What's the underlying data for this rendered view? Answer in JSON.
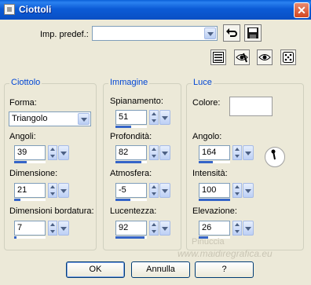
{
  "window": {
    "title": "Ciottoli",
    "close_glyph": "✕"
  },
  "preset": {
    "label": "Imp. predef.:",
    "value": ""
  },
  "toolbar": {
    "icons": [
      "undo-icon",
      "save-icon",
      "settings-list-icon",
      "hide-show-icon",
      "eye-icon",
      "randomize-dice-icon"
    ]
  },
  "groups": {
    "ciottolo": {
      "title": "Ciottolo",
      "forma_label": "Forma:",
      "forma_value": "Triangolo",
      "angoli": {
        "label": "Angoli:",
        "value": "39",
        "level": 0.39
      },
      "dimensione": {
        "label": "Dimensione:",
        "value": "21",
        "level": 0.21
      },
      "bordatura": {
        "label": "Dimensioni bordatura:",
        "value": "7",
        "level": 0.07
      }
    },
    "immagine": {
      "title": "Immagine",
      "spianamento": {
        "label": "Spianamento:",
        "value": "51",
        "level": 0.51
      },
      "profondita": {
        "label": "Profondità:",
        "value": "82",
        "level": 0.82
      },
      "atmosfera": {
        "label": "Atmosfera:",
        "value": "-5",
        "level": 0.47
      },
      "lucentezza": {
        "label": "Lucentezza:",
        "value": "92",
        "level": 0.92
      }
    },
    "luce": {
      "title": "Luce",
      "colore_label": "Colore:",
      "colore_value": "#ffffff",
      "angolo": {
        "label": "Angolo:",
        "value": "164",
        "level": 0.46
      },
      "intensita": {
        "label": "Intensità:",
        "value": "100",
        "level": 1.0
      },
      "elevazione": {
        "label": "Elevazione:",
        "value": "26",
        "level": 0.29
      }
    }
  },
  "buttons": {
    "ok": "OK",
    "cancel": "Annulla",
    "help": "?"
  },
  "watermark": {
    "line1": "Pinuccia",
    "line2": "www.maidiregrafica.eu"
  },
  "colors": {
    "accent": "#0046d5",
    "title_bar": "#0a5fd8",
    "slider_fill": "#3565c8"
  }
}
